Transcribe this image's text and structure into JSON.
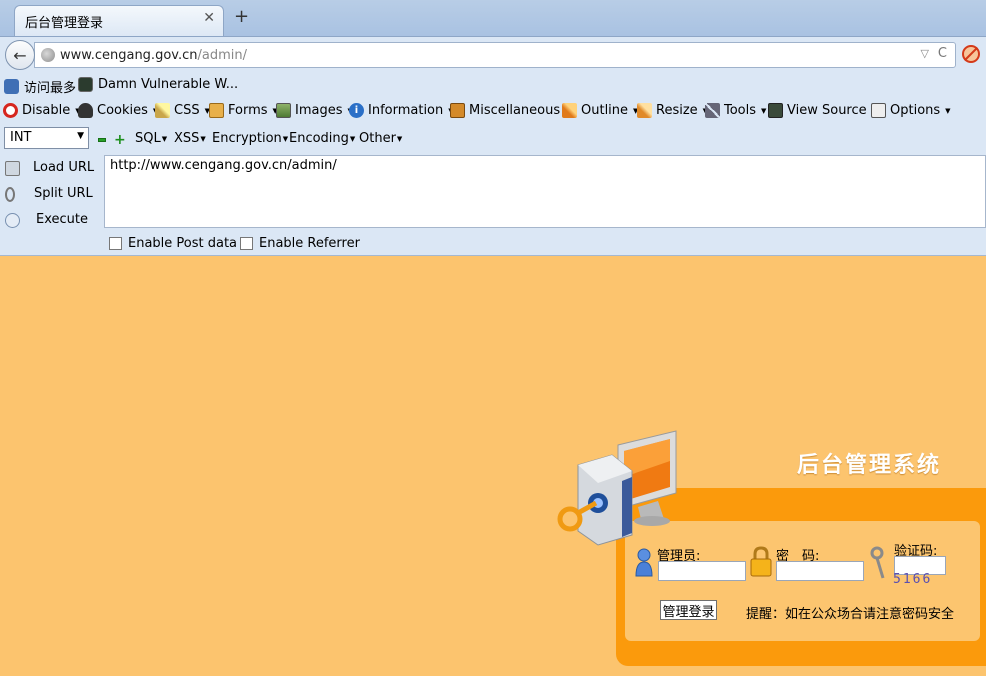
{
  "browser": {
    "tab_title": "后台管理登录",
    "tab_close": "✕",
    "new_tab": "+",
    "back_glyph": "←",
    "url_host": "www.cengang.gov.cn",
    "url_path": "/admin/",
    "url_dropdown": "▽",
    "url_reload": "C"
  },
  "bookmarks": [
    {
      "label": "访问最多",
      "icon": "most-visited-icon"
    },
    {
      "label": "Damn Vulnerable W...",
      "icon": "dvwa-icon"
    }
  ],
  "devtoolbar": [
    {
      "label": "Disable",
      "icon": "disable-icon"
    },
    {
      "label": "Cookies",
      "icon": "cookies-icon"
    },
    {
      "label": "CSS",
      "icon": "css-icon"
    },
    {
      "label": "Forms",
      "icon": "forms-icon"
    },
    {
      "label": "Images",
      "icon": "images-icon"
    },
    {
      "label": "Information",
      "icon": "information-icon"
    },
    {
      "label": "Miscellaneous",
      "icon": "miscellaneous-icon"
    },
    {
      "label": "Outline",
      "icon": "outline-icon"
    },
    {
      "label": "Resize",
      "icon": "resize-icon"
    },
    {
      "label": "Tools",
      "icon": "tools-icon"
    },
    {
      "label": "View Source",
      "icon": "view-source-icon"
    },
    {
      "label": "Options",
      "icon": "options-icon"
    }
  ],
  "hackbar": {
    "type_select": "INT",
    "menus": [
      "SQL",
      "XSS",
      "Encryption",
      "Encoding",
      "Other"
    ],
    "load_url": "Load URL",
    "split_url": "Split URL",
    "execute": "Execute",
    "url_value": "http://www.cengang.gov.cn/admin/",
    "enable_post": "Enable Post data",
    "enable_referrer": "Enable Referrer"
  },
  "login": {
    "system_title": "后台管理系统",
    "admin_label": "管理员:",
    "password_label": "密　码:",
    "captcha_label": "验证码:",
    "captcha_value": "5166",
    "submit_label": "管理登录",
    "tip": "提醒：如在公众场合请注意密码安全"
  },
  "colors": {
    "page_bg": "#fcc46e",
    "frame_orange": "#fb9a0c",
    "chrome_blue": "#dbe7f5"
  }
}
